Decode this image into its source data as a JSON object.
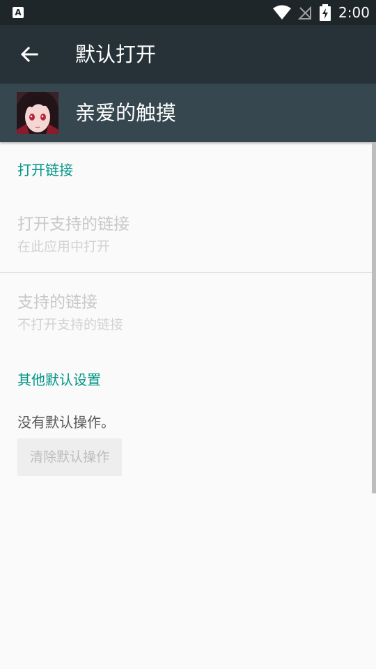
{
  "status_bar": {
    "notification_glyph": "A",
    "icons": [
      "notification-icon",
      "wifi-icon",
      "signal-icon",
      "battery-charging-icon"
    ],
    "time": "2:00"
  },
  "toolbar": {
    "back_icon": "arrow-back-icon",
    "title": "默认打开"
  },
  "app_header": {
    "app_name": "亲爱的触摸"
  },
  "sections": {
    "open_links": {
      "header": "打开链接",
      "open_supported": {
        "title": "打开支持的链接",
        "summary": "在此应用中打开"
      },
      "supported_links": {
        "title": "支持的链接",
        "summary": "不打开支持的链接"
      }
    },
    "other_defaults": {
      "header": "其他默认设置",
      "status_text": "没有默认操作。",
      "clear_button": "清除默认操作"
    }
  },
  "colors": {
    "status_bar": "#1f2629",
    "toolbar": "#263238",
    "app_header": "#37474f",
    "accent": "#009688",
    "background": "#fafafa"
  }
}
